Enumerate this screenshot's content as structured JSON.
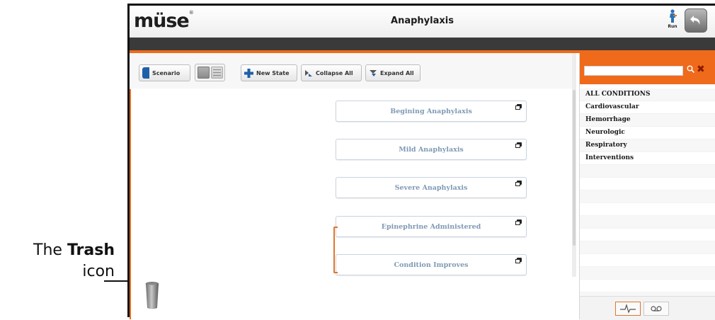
{
  "callout": {
    "prefix": "The",
    "bold": "Trash",
    "suffix": "icon"
  },
  "header": {
    "logo": "müse",
    "title": "Anaphylaxis",
    "run_label": "Run"
  },
  "toolbar": {
    "scenario_label": "Scenario",
    "new_state_label": "New State",
    "collapse_all_label": "Collapse All",
    "expand_all_label": "Expand All"
  },
  "states": [
    {
      "label": "Begining Anaphylaxis"
    },
    {
      "label": "Mild Anaphylaxis"
    },
    {
      "label": "Severe Anaphylaxis"
    },
    {
      "label": "Epinephrine Administered"
    },
    {
      "label": "Condition Improves"
    }
  ],
  "conditions_panel": {
    "search_value": "",
    "items": [
      "ALL CONDITIONS",
      "Cardiovascular",
      "Hemorrhage",
      "Neurologic",
      "Respiratory",
      "Interventions"
    ]
  },
  "colors": {
    "accent_orange": "#ef6a1a",
    "node_text": "#7f9ab5",
    "connector": "#e0772a"
  }
}
